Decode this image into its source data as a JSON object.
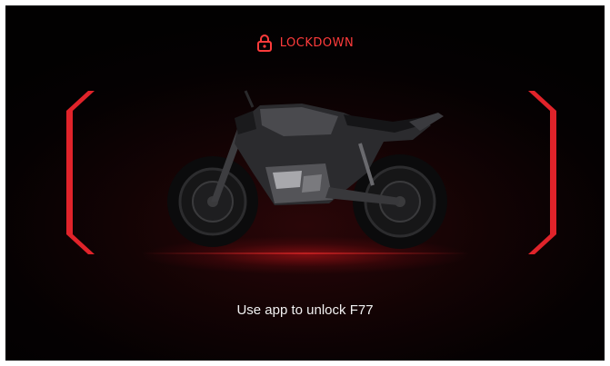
{
  "header": {
    "icon": "lock-icon",
    "label": "LOCKDOWN"
  },
  "message": "Use app to unlock F77",
  "colors": {
    "accent": "#e0232a",
    "header_text": "#ff3b3b",
    "message_text": "#f2f2f2",
    "background": "#050102"
  },
  "brackets": {
    "left_icon": "left-bracket-icon",
    "right_icon": "right-bracket-icon"
  },
  "image": {
    "name": "motorcycle-image"
  }
}
